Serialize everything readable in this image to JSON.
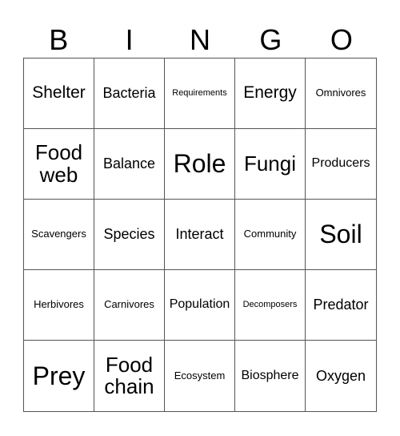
{
  "header": [
    "B",
    "I",
    "N",
    "G",
    "O"
  ],
  "cells": [
    {
      "text": "Shelter",
      "size": "s-lg"
    },
    {
      "text": "Bacteria",
      "size": "s-md2"
    },
    {
      "text": "Requirements",
      "size": "s-xs"
    },
    {
      "text": "Energy",
      "size": "s-lg"
    },
    {
      "text": "Omnivores",
      "size": "s-sm"
    },
    {
      "text": "Food web",
      "size": "s-xl"
    },
    {
      "text": "Balance",
      "size": "s-md2"
    },
    {
      "text": "Role",
      "size": "s-xxl"
    },
    {
      "text": "Fungi",
      "size": "s-xl"
    },
    {
      "text": "Producers",
      "size": "s-md"
    },
    {
      "text": "Scavengers",
      "size": "s-sm"
    },
    {
      "text": "Species",
      "size": "s-md2"
    },
    {
      "text": "Interact",
      "size": "s-md2"
    },
    {
      "text": "Community",
      "size": "s-sm"
    },
    {
      "text": "Soil",
      "size": "s-xxl"
    },
    {
      "text": "Herbivores",
      "size": "s-sm"
    },
    {
      "text": "Carnivores",
      "size": "s-sm"
    },
    {
      "text": "Population",
      "size": "s-md"
    },
    {
      "text": "Decomposers",
      "size": "s-xs"
    },
    {
      "text": "Predator",
      "size": "s-md2"
    },
    {
      "text": "Prey",
      "size": "s-xxl"
    },
    {
      "text": "Food chain",
      "size": "s-xl"
    },
    {
      "text": "Ecosystem",
      "size": "s-sm"
    },
    {
      "text": "Biosphere",
      "size": "s-md"
    },
    {
      "text": "Oxygen",
      "size": "s-md2"
    }
  ]
}
